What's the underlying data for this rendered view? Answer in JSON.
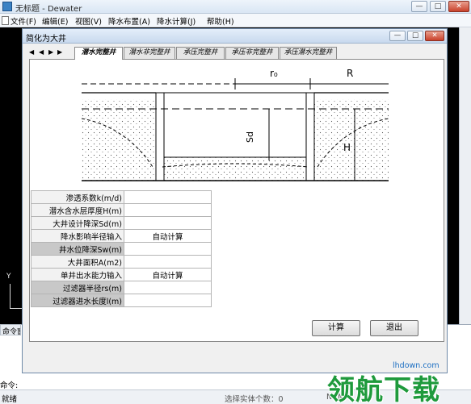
{
  "app": {
    "title": "无标题 - Dewater",
    "min": "—",
    "max": "□",
    "close": "✕"
  },
  "menu": [
    "文件(F)",
    "编辑(E)",
    "视图(V)",
    "降水布置(A)",
    "降水计算(J)",
    "帮助(H)"
  ],
  "canvas": {
    "axis_y_label": "Y"
  },
  "command": {
    "header": "命令窗口",
    "prompt": "命令:"
  },
  "status": {
    "ready": "就绪",
    "entity_count": "选择实体个数：0",
    "num": "NUM"
  },
  "dialog": {
    "title": "简化为大井",
    "min": "—",
    "max": "□",
    "close": "✕",
    "nav": [
      "◀",
      "◀",
      "▶",
      "▶"
    ],
    "tabs": [
      "潜水完整井",
      "潜水非完整井",
      "承压完整井",
      "承压非完整井",
      "承压潜水完整井"
    ],
    "active_tab": 0,
    "diagram": {
      "r0": "r₀",
      "R": "R",
      "sd": "Sd",
      "h": "H"
    },
    "params": [
      {
        "label": "渗透系数k(m/d)",
        "value": "",
        "selected": false
      },
      {
        "label": "潜水含水层厚度H(m)",
        "value": "",
        "selected": false
      },
      {
        "label": "大井设计降深Sd(m)",
        "value": "",
        "selected": false
      },
      {
        "label": "降水影响半径输入",
        "value": "自动计算",
        "selected": false
      },
      {
        "label": "井水位降深Sw(m)",
        "value": "",
        "selected": true
      },
      {
        "label": "大井面积A(m2)",
        "value": "",
        "selected": false
      },
      {
        "label": "单井出水能力输入",
        "value": "自动计算",
        "selected": false
      },
      {
        "label": "过滤器半径rs(m)",
        "value": "",
        "selected": true
      },
      {
        "label": "过滤器进水长度l(m)",
        "value": "",
        "selected": true
      }
    ],
    "calc_label": "计算",
    "exit_label": "退出"
  },
  "watermark": {
    "url": "lhdown.com",
    "text": "领航下载"
  },
  "colors": {
    "canvas_bg": "#000000",
    "dialog_bg": "#f0f0f0",
    "accent": "#3b82c4",
    "watermark": "#1e9a3c"
  }
}
